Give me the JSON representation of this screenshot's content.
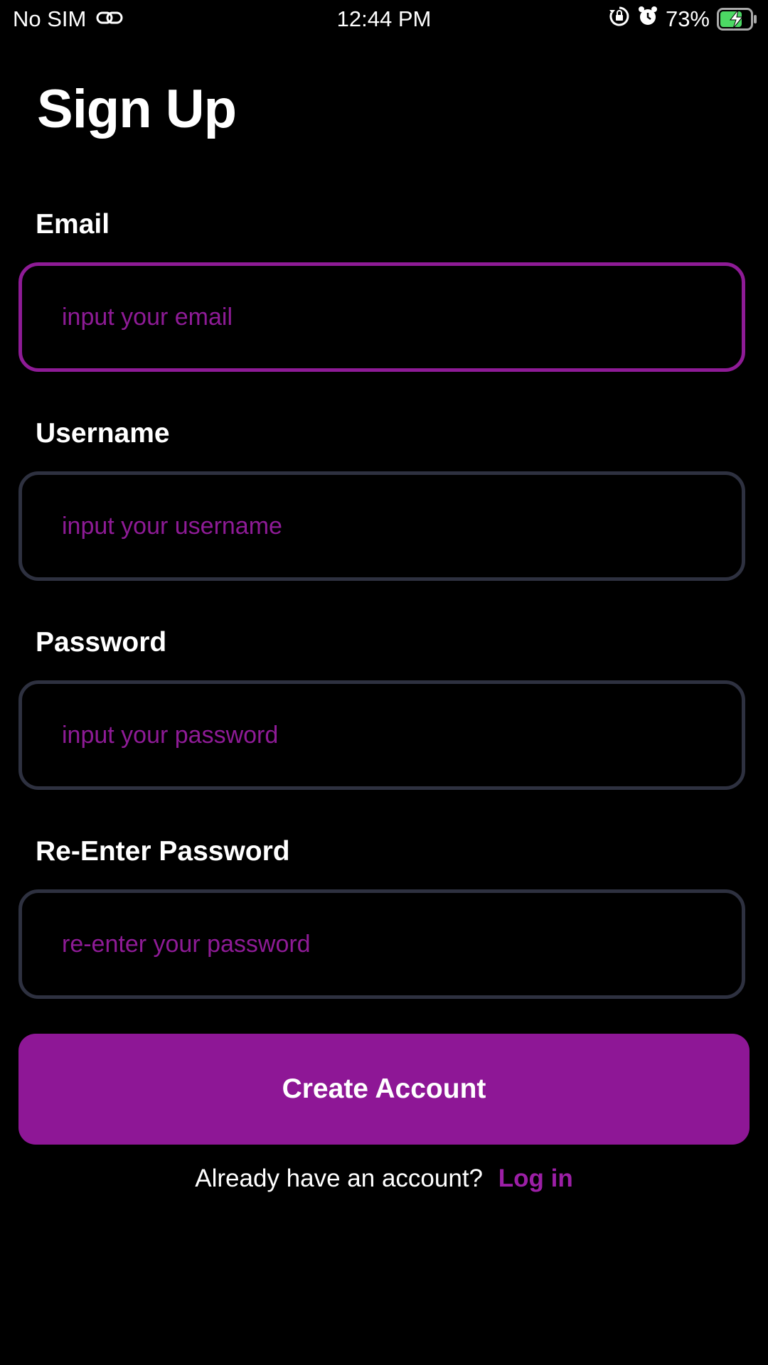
{
  "status_bar": {
    "carrier": "No SIM",
    "time": "12:44 PM",
    "battery_percent": "73%",
    "icons": [
      "link-icon",
      "rotation-lock-icon",
      "alarm-icon",
      "battery-charging-icon"
    ]
  },
  "page": {
    "title": "Sign Up"
  },
  "form": {
    "email": {
      "label": "Email",
      "placeholder": "input your email",
      "value": ""
    },
    "username": {
      "label": "Username",
      "placeholder": "input your username",
      "value": ""
    },
    "password": {
      "label": "Password",
      "placeholder": "input your password",
      "value": ""
    },
    "confirm_password": {
      "label": "Re-Enter Password",
      "placeholder": "re-enter your password",
      "value": ""
    }
  },
  "actions": {
    "create_account_label": "Create Account"
  },
  "footer": {
    "prompt": "Already have an account?",
    "login_label": "Log in"
  },
  "colors": {
    "background": "#000000",
    "accent": "#8e1796",
    "input_border": "#2e3140",
    "text": "#ffffff",
    "battery_fill": "#4cd964"
  }
}
